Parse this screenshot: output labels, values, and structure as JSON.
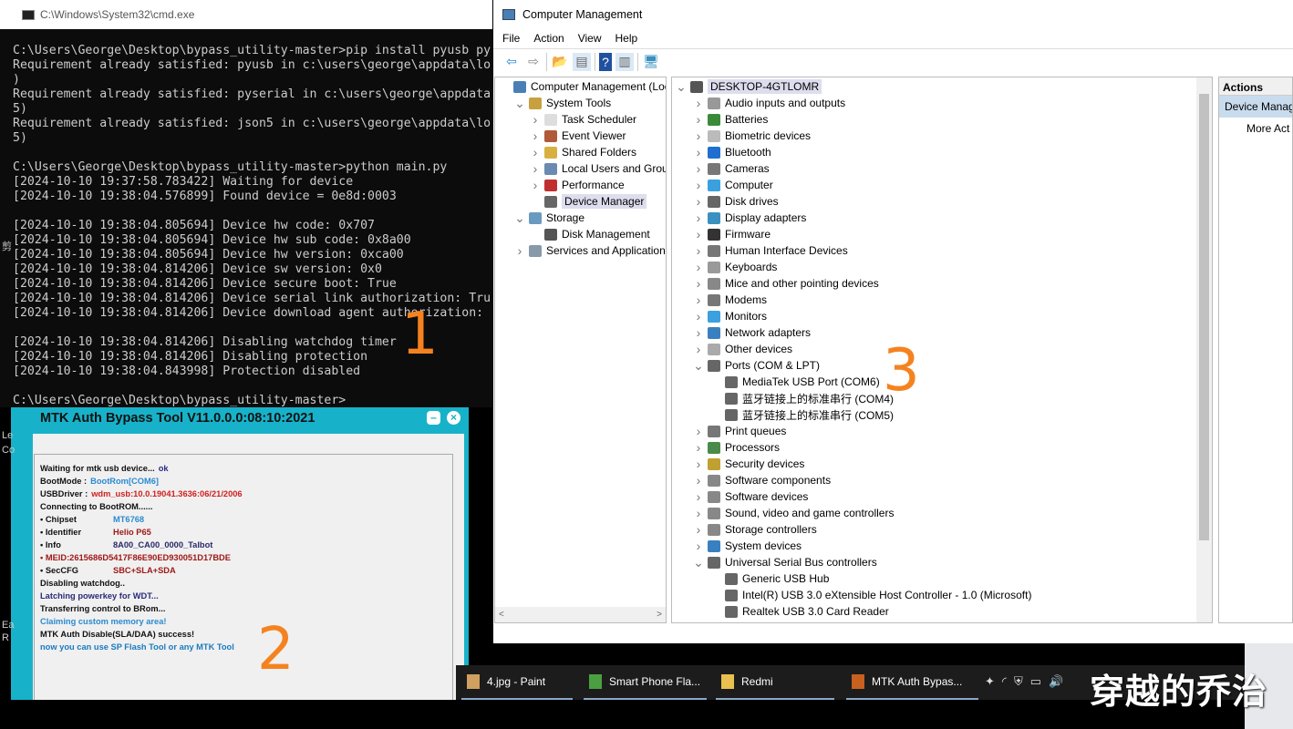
{
  "cmd": {
    "title": "C:\\Windows\\System32\\cmd.exe",
    "lines": [
      "C:\\Users\\George\\Desktop\\bypass_utility-master>pip install pyusb py",
      "Requirement already satisfied: pyusb in c:\\users\\george\\appdata\\lo",
      ")",
      "Requirement already satisfied: pyserial in c:\\users\\george\\appdata",
      "5)",
      "Requirement already satisfied: json5 in c:\\users\\george\\appdata\\lo",
      "5)",
      "",
      "C:\\Users\\George\\Desktop\\bypass_utility-master>python main.py",
      "[2024-10-10 19:37:58.783422] Waiting for device",
      "[2024-10-10 19:38:04.576899] Found device = 0e8d:0003",
      "",
      "[2024-10-10 19:38:04.805694] Device hw code: 0x707",
      "[2024-10-10 19:38:04.805694] Device hw sub code: 0x8a00",
      "[2024-10-10 19:38:04.805694] Device hw version: 0xca00",
      "[2024-10-10 19:38:04.814206] Device sw version: 0x0",
      "[2024-10-10 19:38:04.814206] Device secure boot: True",
      "[2024-10-10 19:38:04.814206] Device serial link authorization: Tru",
      "[2024-10-10 19:38:04.814206] Device download agent authorization:",
      "",
      "[2024-10-10 19:38:04.814206] Disabling watchdog timer",
      "[2024-10-10 19:38:04.814206] Disabling protection",
      "[2024-10-10 19:38:04.843998] Protection disabled",
      "",
      "C:\\Users\\George\\Desktop\\bypass_utility-master>"
    ]
  },
  "left_edge": [
    "剪",
    "Le",
    "Co",
    "Ea",
    "R"
  ],
  "cm": {
    "title": "Computer Management",
    "menu": [
      "File",
      "Action",
      "View",
      "Help"
    ],
    "toolbar": [
      "back-arrow-icon",
      "forward-arrow-icon",
      "up-folder-icon",
      "show-hide-tree-icon",
      "help-icon",
      "show-action-pane-icon",
      "monitor-icon"
    ],
    "nav": [
      {
        "label": "Computer Management (Local",
        "level": 0,
        "chev": "",
        "icon": "computer-management-icon",
        "color": "#4a7fb5"
      },
      {
        "label": "System Tools",
        "level": 1,
        "chev": "v",
        "icon": "tools-icon",
        "color": "#c8a040"
      },
      {
        "label": "Task Scheduler",
        "level": 2,
        "chev": ">",
        "icon": "clock-icon",
        "color": "#ddd"
      },
      {
        "label": "Event Viewer",
        "level": 2,
        "chev": ">",
        "icon": "event-viewer-icon",
        "color": "#b05a3a"
      },
      {
        "label": "Shared Folders",
        "level": 2,
        "chev": ">",
        "icon": "shared-folder-icon",
        "color": "#d8b040"
      },
      {
        "label": "Local Users and Groups",
        "level": 2,
        "chev": ">",
        "icon": "users-icon",
        "color": "#6a8ab0"
      },
      {
        "label": "Performance",
        "level": 2,
        "chev": ">",
        "icon": "performance-icon",
        "color": "#c03030"
      },
      {
        "label": "Device Manager",
        "level": 2,
        "chev": "",
        "icon": "device-manager-icon",
        "color": "#666",
        "selected": true
      },
      {
        "label": "Storage",
        "level": 1,
        "chev": "v",
        "icon": "storage-icon",
        "color": "#6a9ac0"
      },
      {
        "label": "Disk Management",
        "level": 2,
        "chev": "",
        "icon": "disk-icon",
        "color": "#555"
      },
      {
        "label": "Services and Applications",
        "level": 1,
        "chev": ">",
        "icon": "services-icon",
        "color": "#8899aa"
      }
    ],
    "tree": [
      {
        "label": "DESKTOP-4GTLOMR",
        "level": 0,
        "chev": "v",
        "icon": "computer-icon",
        "color": "#555",
        "selected": true
      },
      {
        "label": "Audio inputs and outputs",
        "level": 1,
        "chev": ">",
        "icon": "speaker-icon",
        "color": "#999"
      },
      {
        "label": "Batteries",
        "level": 1,
        "chev": ">",
        "icon": "battery-icon",
        "color": "#3a8a3a"
      },
      {
        "label": "Biometric devices",
        "level": 1,
        "chev": ">",
        "icon": "fingerprint-icon",
        "color": "#bbb"
      },
      {
        "label": "Bluetooth",
        "level": 1,
        "chev": ">",
        "icon": "bluetooth-icon",
        "color": "#1f6fd0"
      },
      {
        "label": "Cameras",
        "level": 1,
        "chev": ">",
        "icon": "camera-icon",
        "color": "#777"
      },
      {
        "label": "Computer",
        "level": 1,
        "chev": ">",
        "icon": "monitor-icon",
        "color": "#3aa0e0"
      },
      {
        "label": "Disk drives",
        "level": 1,
        "chev": ">",
        "icon": "disk-drive-icon",
        "color": "#666"
      },
      {
        "label": "Display adapters",
        "level": 1,
        "chev": ">",
        "icon": "display-adapter-icon",
        "color": "#3a90c0"
      },
      {
        "label": "Firmware",
        "level": 1,
        "chev": ">",
        "icon": "chip-icon",
        "color": "#333"
      },
      {
        "label": "Human Interface Devices",
        "level": 1,
        "chev": ">",
        "icon": "hid-icon",
        "color": "#777"
      },
      {
        "label": "Keyboards",
        "level": 1,
        "chev": ">",
        "icon": "keyboard-icon",
        "color": "#999"
      },
      {
        "label": "Mice and other pointing devices",
        "level": 1,
        "chev": ">",
        "icon": "mouse-icon",
        "color": "#888"
      },
      {
        "label": "Modems",
        "level": 1,
        "chev": ">",
        "icon": "modem-icon",
        "color": "#777"
      },
      {
        "label": "Monitors",
        "level": 1,
        "chev": ">",
        "icon": "monitor-icon",
        "color": "#3aa0e0"
      },
      {
        "label": "Network adapters",
        "level": 1,
        "chev": ">",
        "icon": "network-adapter-icon",
        "color": "#3a80c0"
      },
      {
        "label": "Other devices",
        "level": 1,
        "chev": ">",
        "icon": "unknown-device-icon",
        "color": "#aaa"
      },
      {
        "label": "Ports (COM & LPT)",
        "level": 1,
        "chev": "v",
        "icon": "port-icon",
        "color": "#666"
      },
      {
        "label": "MediaTek USB Port (COM6)",
        "level": 2,
        "chev": "",
        "icon": "port-icon",
        "color": "#666"
      },
      {
        "label": "蓝牙链接上的标准串行 (COM4)",
        "level": 2,
        "chev": "",
        "icon": "port-icon",
        "color": "#666"
      },
      {
        "label": "蓝牙链接上的标准串行 (COM5)",
        "level": 2,
        "chev": "",
        "icon": "port-icon",
        "color": "#666"
      },
      {
        "label": "Print queues",
        "level": 1,
        "chev": ">",
        "icon": "printer-icon",
        "color": "#777"
      },
      {
        "label": "Processors",
        "level": 1,
        "chev": ">",
        "icon": "processor-icon",
        "color": "#4a8a4a"
      },
      {
        "label": "Security devices",
        "level": 1,
        "chev": ">",
        "icon": "security-device-icon",
        "color": "#c0a030"
      },
      {
        "label": "Software components",
        "level": 1,
        "chev": ">",
        "icon": "software-component-icon",
        "color": "#888"
      },
      {
        "label": "Software devices",
        "level": 1,
        "chev": ">",
        "icon": "software-device-icon",
        "color": "#888"
      },
      {
        "label": "Sound, video and game controllers",
        "level": 1,
        "chev": ">",
        "icon": "sound-icon",
        "color": "#888"
      },
      {
        "label": "Storage controllers",
        "level": 1,
        "chev": ">",
        "icon": "storage-controller-icon",
        "color": "#888"
      },
      {
        "label": "System devices",
        "level": 1,
        "chev": ">",
        "icon": "system-device-icon",
        "color": "#3a80c0"
      },
      {
        "label": "Universal Serial Bus controllers",
        "level": 1,
        "chev": "v",
        "icon": "usb-icon",
        "color": "#666"
      },
      {
        "label": "Generic USB Hub",
        "level": 2,
        "chev": "",
        "icon": "usb-icon",
        "color": "#666"
      },
      {
        "label": "Intel(R) USB 3.0 eXtensible Host Controller - 1.0 (Microsoft)",
        "level": 2,
        "chev": "",
        "icon": "usb-icon",
        "color": "#666"
      },
      {
        "label": "Realtek USB 3.0 Card Reader",
        "level": 2,
        "chev": "",
        "icon": "usb-icon",
        "color": "#666"
      }
    ],
    "actions": {
      "header": "Actions",
      "device_manager": "Device Manag",
      "more": "More Act"
    }
  },
  "mtk": {
    "title": "MTK Auth Bypass Tool V11.0.0.0:08:10:2021",
    "log": [
      {
        "text": "Waiting for mtk usb device...",
        "value": "ok",
        "color": "#111",
        "vcolor": "#2a2a8a"
      },
      {
        "text": "BootMode :",
        "value": "BootRom[COM6]",
        "color": "#111",
        "vcolor": "#2a8ad0"
      },
      {
        "text": "USBDriver :",
        "value": "wdm_usb:10.0.19041.3636:06/21/2006",
        "color": "#111",
        "vcolor": "#d02020"
      },
      {
        "text": "Connecting to BootROM......",
        "value": "",
        "color": "#111"
      },
      {
        "text": "• Chipset",
        "value": "MT6768",
        "color": "#111",
        "vcolor": "#2a8ad0",
        "kv": true
      },
      {
        "text": "• Identifier",
        "value": "Helio P65",
        "color": "#111",
        "vcolor": "#a01818",
        "kv": true
      },
      {
        "text": "• Info",
        "value": "8A00_CA00_0000_Talbot",
        "color": "#111",
        "vcolor": "#2a2a6a",
        "kv": true
      },
      {
        "text": "• MEID:2615686D5417F86E90ED930051D17BDE",
        "value": "",
        "color": "#a01818"
      },
      {
        "text": "• SecCFG",
        "value": "SBC+SLA+SDA",
        "color": "#111",
        "vcolor": "#a01818",
        "kv": true
      },
      {
        "text": "Disabling watchdog..",
        "value": "",
        "color": "#111"
      },
      {
        "text": "Latching powerkey for WDT...",
        "value": "",
        "color": "#2a2a7a"
      },
      {
        "text": "Transferring control to BRom...",
        "value": "",
        "color": "#111"
      },
      {
        "text": "Claiming custom memory area!",
        "value": "",
        "color": "#2a8ad0"
      },
      {
        "text": "MTK Auth Disable(SLA/DAA) success!",
        "value": "",
        "color": "#111"
      },
      {
        "text": "now you can use SP Flash Tool or any MTK Tool",
        "value": "",
        "color": "#1a7ac0"
      }
    ]
  },
  "taskbar": {
    "items": [
      {
        "label": "4.jpg - Paint",
        "icon": "paint-icon",
        "color": "#d0a060"
      },
      {
        "label": "Smart Phone Fla...",
        "icon": "flash-tool-icon",
        "color": "#4aa040"
      },
      {
        "label": "Redmi",
        "icon": "folder-icon",
        "color": "#e8c050"
      },
      {
        "label": "MTK Auth Bypas...",
        "icon": "mtk-tool-icon",
        "color": "#c86020"
      }
    ],
    "tray": [
      "bluetooth-tray-icon",
      "wifi-icon",
      "security-icon",
      "battery-icon",
      "volume-icon"
    ]
  },
  "annotations": [
    "1",
    "2",
    "3"
  ],
  "watermark": "穿越的乔治"
}
